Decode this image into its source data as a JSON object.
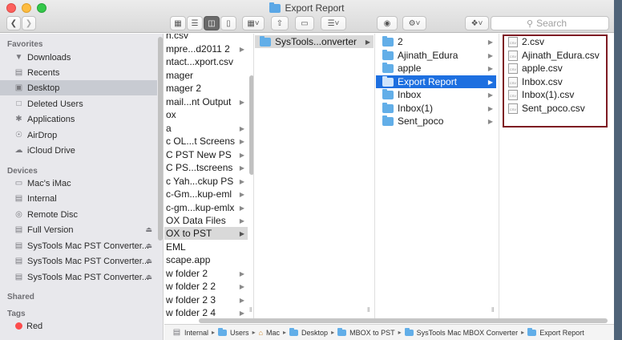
{
  "window": {
    "title": "Export Report",
    "search_placeholder": "Search"
  },
  "sidebar": {
    "favorites_title": "Favorites",
    "favorites": [
      {
        "label": "Downloads",
        "icon": "downloads-icon"
      },
      {
        "label": "Recents",
        "icon": "clock-icon"
      },
      {
        "label": "Desktop",
        "icon": "desktop-icon",
        "selected": true
      },
      {
        "label": "Deleted Users",
        "icon": "folder-icon"
      },
      {
        "label": "Applications",
        "icon": "applications-icon"
      },
      {
        "label": "AirDrop",
        "icon": "airdrop-icon"
      },
      {
        "label": "iCloud Drive",
        "icon": "cloud-icon"
      }
    ],
    "devices_title": "Devices",
    "devices": [
      {
        "label": "Mac's iMac",
        "icon": "imac-icon"
      },
      {
        "label": "Internal",
        "icon": "drive-icon"
      },
      {
        "label": "Remote Disc",
        "icon": "disc-icon"
      },
      {
        "label": "Full Version",
        "icon": "drive-icon",
        "eject": true
      },
      {
        "label": "SysTools Mac PST Converter...",
        "icon": "drive-icon",
        "eject": true
      },
      {
        "label": "SysTools Mac PST Converter...",
        "icon": "drive-icon",
        "eject": true
      },
      {
        "label": "SysTools Mac PST Converter...",
        "icon": "drive-icon",
        "eject": true
      }
    ],
    "shared_title": "Shared",
    "tags_title": "Tags",
    "tags": [
      {
        "label": "Red",
        "color": "#fc4c4c"
      }
    ]
  },
  "column1": {
    "items": [
      {
        "label": "n.csv"
      },
      {
        "label": "mpre...d2011 2",
        "chevron": true
      },
      {
        "label": "ntact...xport.csv"
      },
      {
        "label": "mager"
      },
      {
        "label": "mager 2"
      },
      {
        "label": "mail...nt Output",
        "chevron": true
      },
      {
        "label": "ox"
      },
      {
        "label": "a",
        "chevron": true
      },
      {
        "label": "c OL...t Screens",
        "chevron": true
      },
      {
        "label": "C PST New PS",
        "chevron": true
      },
      {
        "label": "C PS...tscreens",
        "chevron": true
      },
      {
        "label": "c Yah...ckup PS",
        "chevron": true
      },
      {
        "label": "c-Gm...kup-eml",
        "chevron": true
      },
      {
        "label": "c-gm...kup-emlx",
        "chevron": true
      },
      {
        "label": "OX Data Files",
        "chevron": true
      },
      {
        "label": "OX to PST",
        "chevron": true,
        "selected": true
      },
      {
        "label": "EML"
      },
      {
        "label": "scape.app"
      },
      {
        "label": "w folder 2",
        "chevron": true
      },
      {
        "label": "w folder 2 2",
        "chevron": true
      },
      {
        "label": "w folder 2 3",
        "chevron": true
      },
      {
        "label": "w folder 2 4",
        "chevron": true
      }
    ]
  },
  "column2": {
    "items": [
      {
        "label": "SysTools...onverter",
        "chevron": true,
        "selected": true
      }
    ]
  },
  "column3": {
    "items": [
      {
        "label": "2",
        "chevron": true
      },
      {
        "label": "Ajinath_Edura",
        "chevron": true
      },
      {
        "label": "apple",
        "chevron": true
      },
      {
        "label": "Export Report",
        "chevron": true,
        "selected": true
      },
      {
        "label": "Inbox",
        "chevron": true
      },
      {
        "label": "Inbox(1)",
        "chevron": true
      },
      {
        "label": "Sent_poco",
        "chevron": true
      }
    ]
  },
  "column4": {
    "items": [
      {
        "label": "2.csv"
      },
      {
        "label": "Ajinath_Edura.csv"
      },
      {
        "label": "apple.csv"
      },
      {
        "label": "Inbox.csv"
      },
      {
        "label": "Inbox(1).csv"
      },
      {
        "label": "Sent_poco.csv"
      }
    ]
  },
  "pathbar": [
    "Internal",
    "Users",
    "Mac",
    "Desktop",
    "MBOX to PST",
    "SysTools Mac MBOX Converter",
    "Export Report"
  ],
  "colors": {
    "selection_blue": "#1d6fe0",
    "highlight_box": "#7d1a22"
  }
}
